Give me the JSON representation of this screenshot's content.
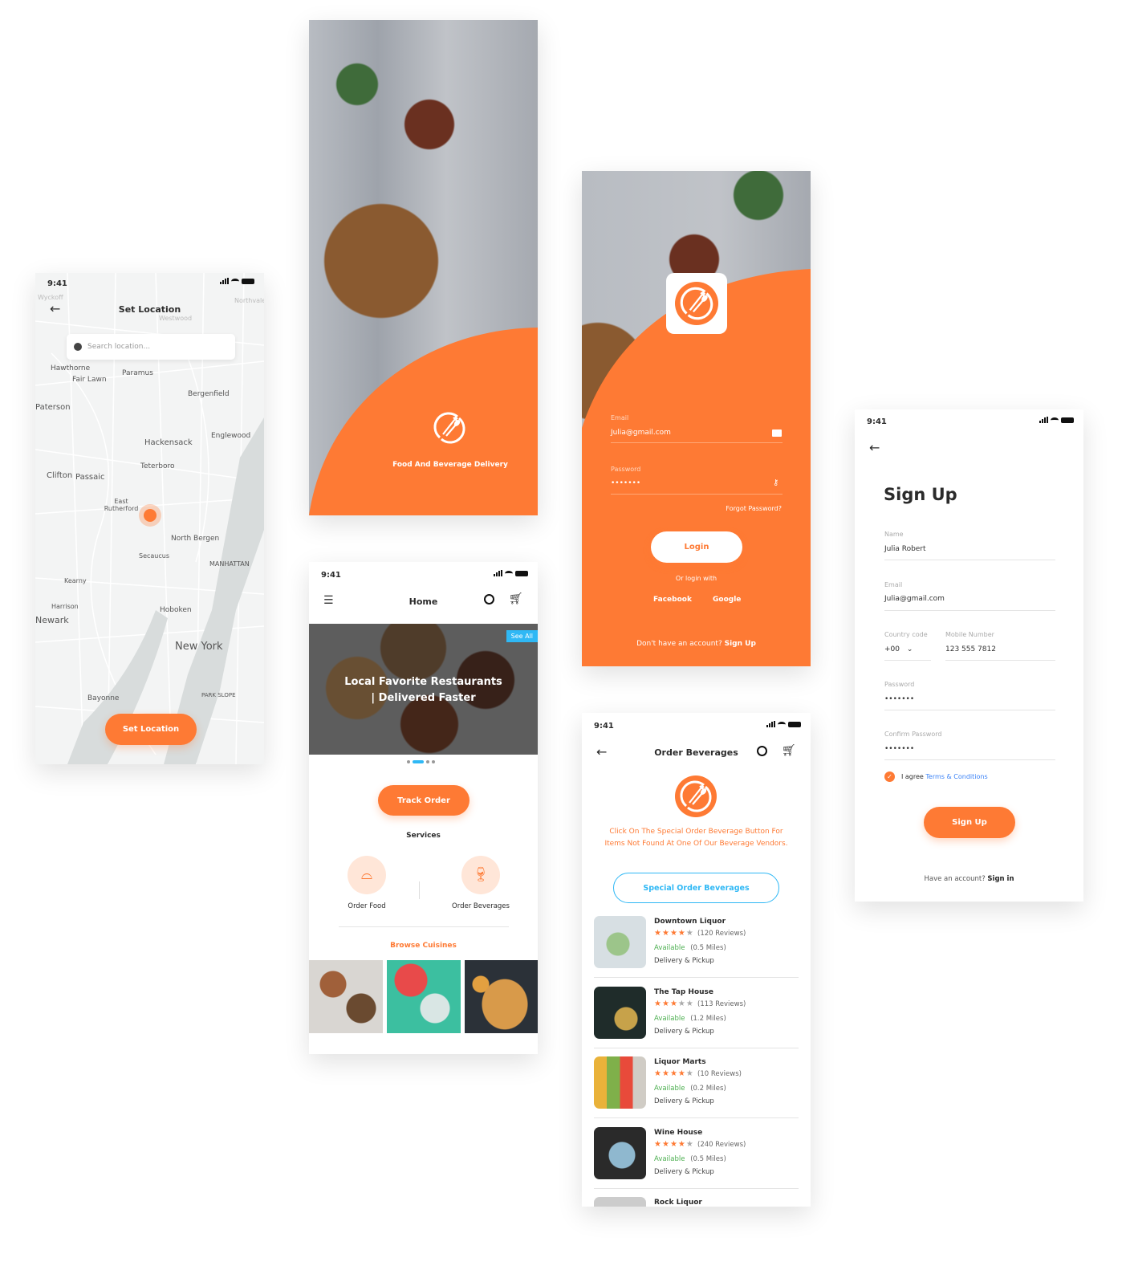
{
  "colors": {
    "accent": "#fe7a34",
    "link": "#3b82f6",
    "available": "#4caf50",
    "badge": "#2fb8f5"
  },
  "status_time": "9:41",
  "map_screen": {
    "title": "Set Location",
    "search_placeholder": "Search location...",
    "button": "Set Location",
    "labels": [
      "Hawthorne",
      "Fair Lawn",
      "Paramus",
      "Bergenfield",
      "Paterson",
      "Hackensack",
      "Englewood",
      "Teterboro",
      "Clifton",
      "Passaic",
      "East Rutherford",
      "North Bergen",
      "Secaucus",
      "MANHATTAN",
      "Kearny",
      "Harrison",
      "Hoboken",
      "Newark",
      "New York",
      "Bayonne",
      "PARK SLOPE",
      "Westwood",
      "Northvale",
      "Wyckoff"
    ]
  },
  "splash": {
    "tagline": "Food And Beverage Delivery"
  },
  "login": {
    "email_label": "Email",
    "email_value": "Julia@gmail.com",
    "password_label": "Password",
    "password_value": "•••••••",
    "forgot": "Forgot Password?",
    "login_button": "Login",
    "or_login": "Or login with",
    "facebook": "Facebook",
    "google": "Google",
    "no_account": "Don't have an account?",
    "sign_up": "Sign Up"
  },
  "signup": {
    "title": "Sign Up",
    "name_label": "Name",
    "name_value": "Julia Robert",
    "email_label": "Email",
    "email_value": "Julia@gmail.com",
    "country_label": "Country code",
    "country_value": "+00",
    "mobile_label": "Mobile Number",
    "mobile_value": "123 555 7812",
    "password_label": "Password",
    "password_value": "•••••••",
    "confirm_label": "Confirm Password",
    "confirm_value": "•••••••",
    "agree": "I agree",
    "terms": "Terms & Conditions",
    "agree_checked": true,
    "button": "Sign Up",
    "have_account": "Have an account?",
    "sign_in": "Sign in"
  },
  "home": {
    "title": "Home",
    "banner": "Local Favorite Restaurants | Delivered Faster",
    "see_all": "See All",
    "track_order": "Track Order",
    "services_title": "Services",
    "services": [
      {
        "label": "Order Food",
        "icon": "cloche-icon"
      },
      {
        "label": "Order Beverages",
        "icon": "wine-glass-icon"
      }
    ],
    "browse": "Browse Cuisines",
    "carousel_active_index": 1
  },
  "beverages": {
    "title": "Order Beverages",
    "info": "Click On The Special Order Beverage Button For Items Not Found At One Of Our Beverage Vendors.",
    "special_button": "Special Order Beverages",
    "vendors": [
      {
        "name": "Downtown Liquor",
        "rating": 4,
        "reviews": "(120 Reviews)",
        "status": "Available",
        "distance": "(0.5 Miles)",
        "service": "Delivery & Pickup"
      },
      {
        "name": "The Tap House",
        "rating": 3,
        "reviews": "(113 Reviews)",
        "status": "Available",
        "distance": "(1.2 Miles)",
        "service": "Delivery & Pickup"
      },
      {
        "name": "Liquor Marts",
        "rating": 4,
        "reviews": "(10 Reviews)",
        "status": "Available",
        "distance": "(0.2 Miles)",
        "service": "Delivery & Pickup"
      },
      {
        "name": "Wine House",
        "rating": 4,
        "reviews": "(240 Reviews)",
        "status": "Available",
        "distance": "(0.5 Miles)",
        "service": "Delivery & Pickup"
      },
      {
        "name": "Rock Liquor"
      }
    ]
  }
}
